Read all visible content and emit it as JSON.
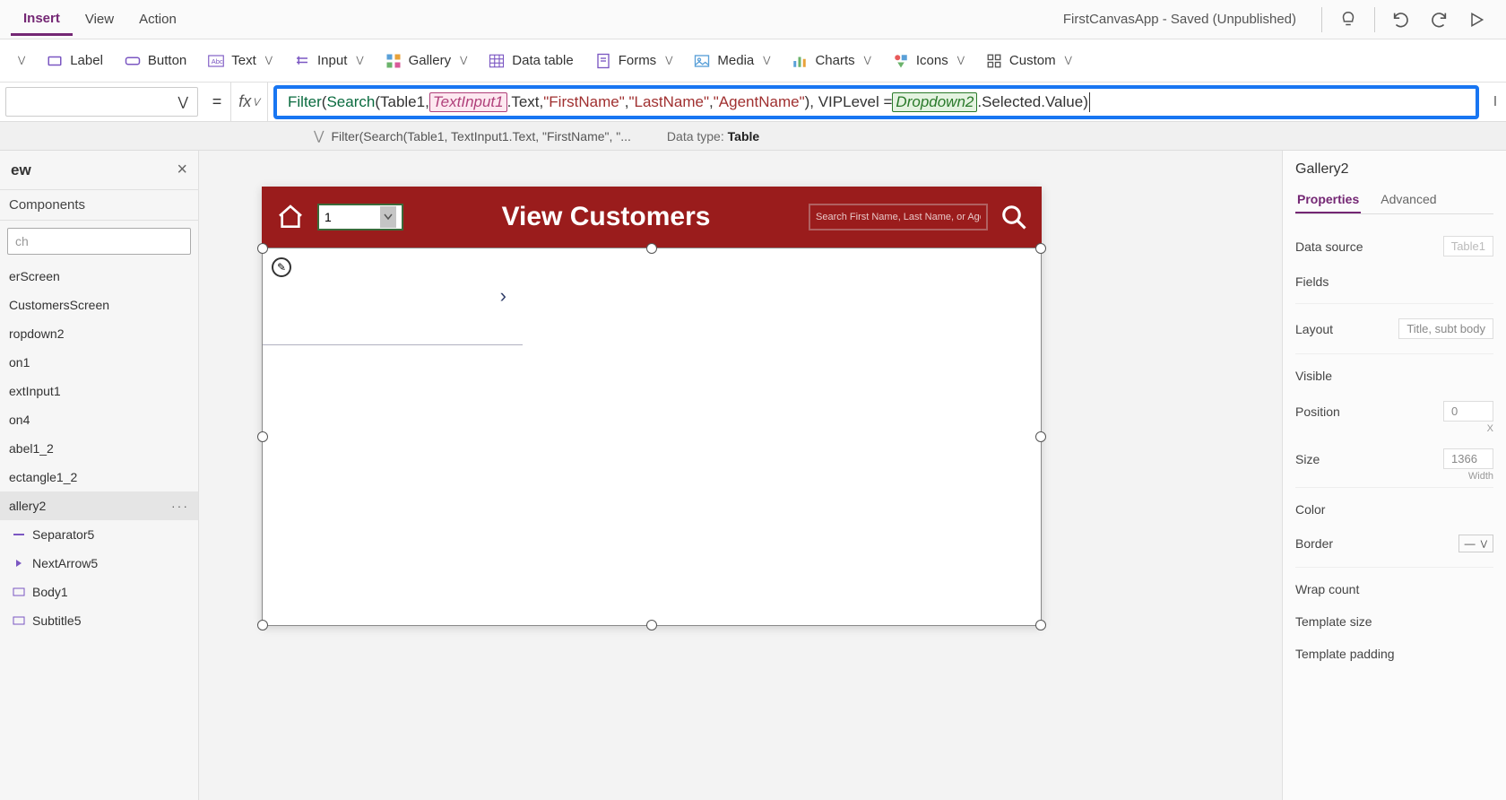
{
  "topMenu": {
    "insert": "Insert",
    "view": "View",
    "action": "Action"
  },
  "appTitle": "FirstCanvasApp - Saved (Unpublished)",
  "ribbon": {
    "label": "Label",
    "button": "Button",
    "text": "Text",
    "input": "Input",
    "gallery": "Gallery",
    "datatable": "Data table",
    "forms": "Forms",
    "media": "Media",
    "charts": "Charts",
    "icons": "Icons",
    "custom": "Custom"
  },
  "formula": {
    "parts": [
      "Filter",
      "(",
      "Search",
      "(",
      "Table1",
      ", ",
      "TextInput1",
      ".Text",
      ", ",
      "\"FirstName\"",
      ", ",
      "\"LastName\"",
      ", ",
      "\"AgentName\"",
      "), VIPLevel = ",
      "Dropdown2",
      ".Selected.Value)"
    ],
    "summary": "Filter(Search(Table1, TextInput1.Text, \"FirstName\", \"...",
    "datatypeLabel": "Data type:",
    "datatype": "Table"
  },
  "leftPanel": {
    "title": "ew",
    "tabComponents": "Components",
    "searchPlaceholder": "ch",
    "tree": [
      "erScreen",
      "CustomersScreen",
      "ropdown2",
      "on1",
      "extInput1",
      "on4",
      "abel1_2",
      "ectangle1_2",
      "allery2",
      "Separator5",
      "NextArrow5",
      "Body1",
      "Subtitle5"
    ],
    "selectedIndex": 8
  },
  "preview": {
    "title": "View Customers",
    "dropdownValue": "1",
    "searchPlaceholder": "Search First Name, Last Name, or Age"
  },
  "rightPanel": {
    "selection": "Gallery2",
    "tabProperties": "Properties",
    "tabAdvanced": "Advanced",
    "props": {
      "datasource": "Data source",
      "datasourceVal": "Table1",
      "fields": "Fields",
      "layout": "Layout",
      "layoutVal": "Title, subt body",
      "visible": "Visible",
      "position": "Position",
      "positionVal": "0",
      "positionSub": "X",
      "size": "Size",
      "sizeVal": "1366",
      "sizeSub": "Width",
      "color": "Color",
      "border": "Border",
      "wrap": "Wrap count",
      "tplsize": "Template size",
      "tplpad": "Template padding"
    }
  }
}
